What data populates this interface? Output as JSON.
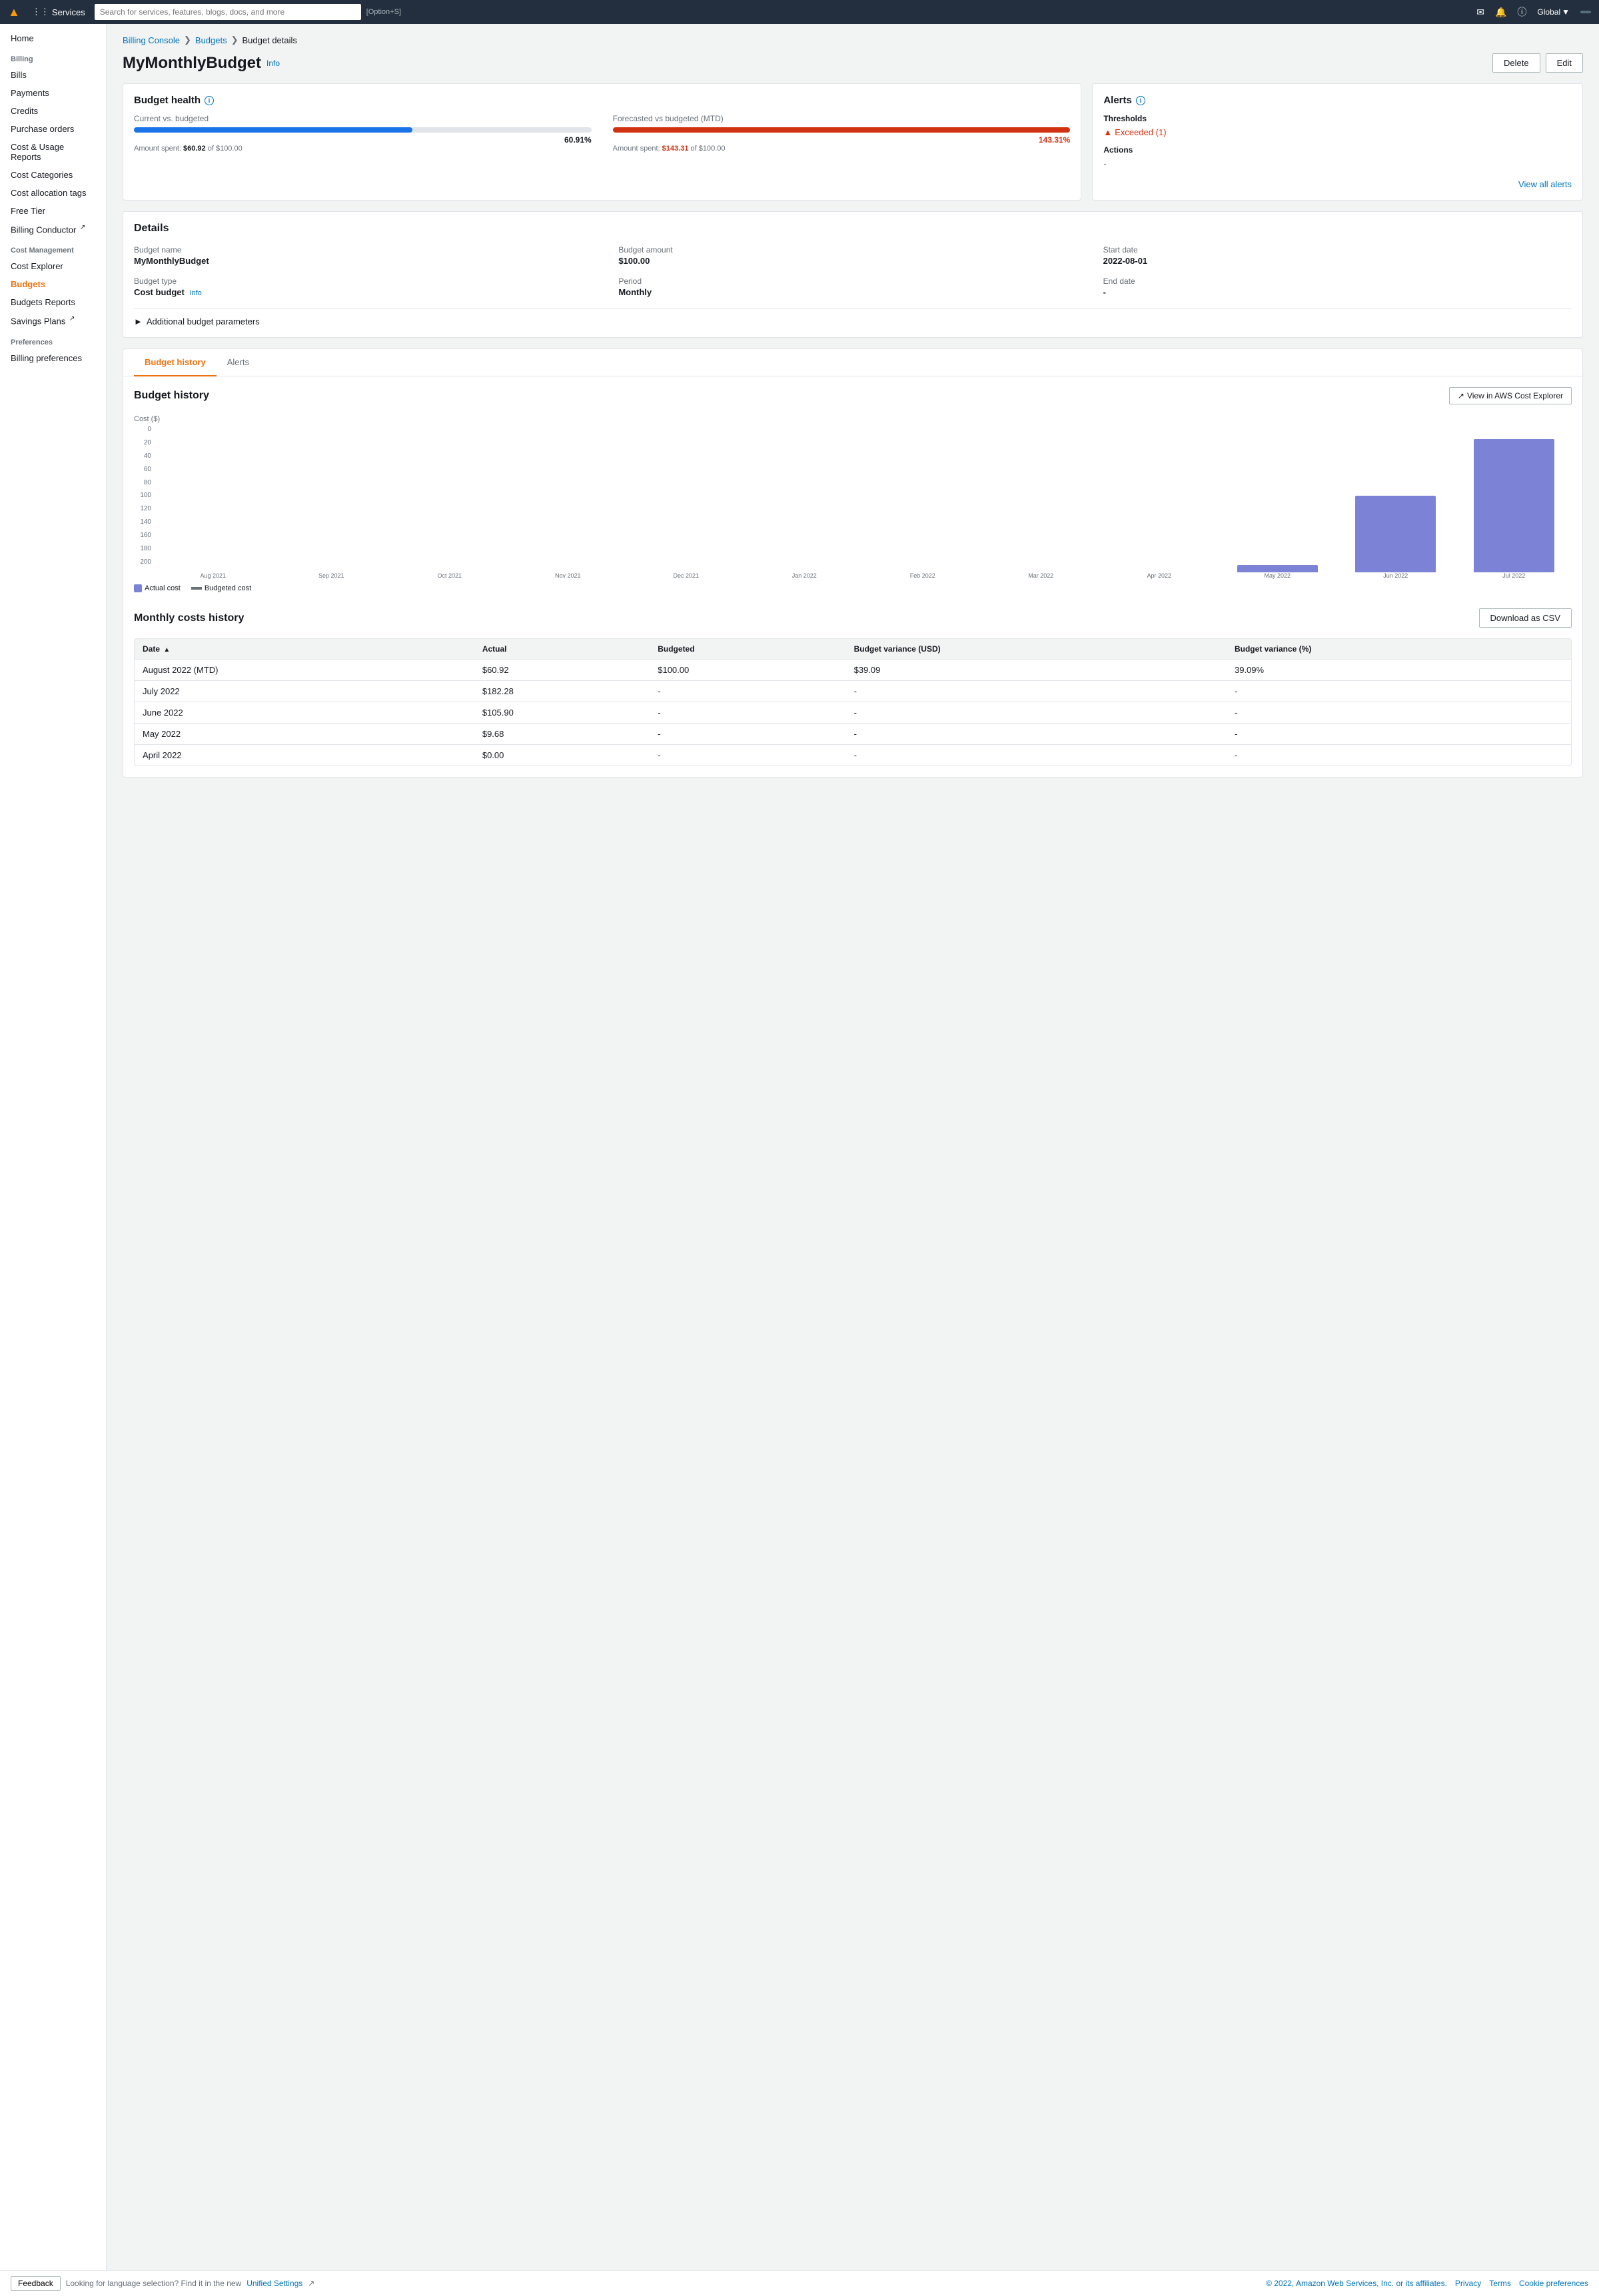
{
  "topnav": {
    "aws_logo": "aws",
    "services_label": "Services",
    "search_placeholder": "Search for services, features, blogs, docs, and more",
    "search_hint": "[Option+S]",
    "global_label": "Global",
    "account_label": ""
  },
  "sidebar": {
    "home_label": "Home",
    "billing_section": "Billing",
    "bills_label": "Bills",
    "payments_label": "Payments",
    "credits_label": "Credits",
    "purchase_orders_label": "Purchase orders",
    "cost_usage_reports_label": "Cost & Usage Reports",
    "cost_categories_label": "Cost Categories",
    "cost_allocation_tags_label": "Cost allocation tags",
    "free_tier_label": "Free Tier",
    "billing_conductor_label": "Billing Conductor",
    "cost_management_section": "Cost Management",
    "cost_explorer_label": "Cost Explorer",
    "budgets_label": "Budgets",
    "budgets_reports_label": "Budgets Reports",
    "savings_plans_label": "Savings Plans",
    "preferences_section": "Preferences",
    "billing_preferences_label": "Billing preferences"
  },
  "breadcrumb": {
    "billing_console": "Billing Console",
    "budgets": "Budgets",
    "budget_details": "Budget details"
  },
  "page": {
    "title": "MyMonthlyBudget",
    "info_label": "Info",
    "delete_label": "Delete",
    "edit_label": "Edit"
  },
  "budget_health": {
    "title": "Budget health",
    "info_label": "Info",
    "current_vs_budgeted_label": "Current vs. budgeted",
    "current_percent": "60.91%",
    "current_bar_width": "60.91",
    "current_amount": "Amount spent: $60.92 of $100.00",
    "current_amount_spent": "$60.92",
    "current_amount_total": "$100.00",
    "forecasted_vs_budgeted_label": "Forecasted vs budgeted (MTD)",
    "forecasted_percent": "143.31%",
    "forecasted_bar_width": "100",
    "forecasted_amount": "Amount spent: $143.31 of $100.00",
    "forecasted_amount_spent": "$143.31",
    "forecasted_amount_total": "$100.00"
  },
  "alerts": {
    "title": "Alerts",
    "info_label": "Info",
    "thresholds_label": "Thresholds",
    "exceeded_label": "Exceeded (1)",
    "actions_label": "Actions",
    "actions_value": "-",
    "view_all_label": "View all alerts"
  },
  "details": {
    "title": "Details",
    "budget_name_label": "Budget name",
    "budget_name_value": "MyMonthlyBudget",
    "budget_amount_label": "Budget amount",
    "budget_amount_value": "$100.00",
    "start_date_label": "Start date",
    "start_date_value": "2022-08-01",
    "budget_type_label": "Budget type",
    "budget_type_value": "Cost budget",
    "budget_type_info": "Info",
    "period_label": "Period",
    "period_value": "Monthly",
    "end_date_label": "End date",
    "end_date_value": "-",
    "additional_params_label": "Additional budget parameters"
  },
  "tabs": {
    "budget_history_label": "Budget history",
    "alerts_label": "Alerts"
  },
  "budget_history": {
    "title": "Budget history",
    "view_in_explorer_label": "View in AWS Cost Explorer",
    "cost_axis_label": "Cost ($)",
    "y_axis": [
      "0",
      "20",
      "40",
      "60",
      "80",
      "100",
      "120",
      "140",
      "160",
      "180",
      "200"
    ],
    "x_labels": [
      "Aug 2021",
      "Sep 2021",
      "Oct 2021",
      "Nov 2021",
      "Dec 2021",
      "Jan 2022",
      "Feb 2022",
      "Mar 2022",
      "Apr 2022",
      "May 2022",
      "Jun 2022",
      "Jul 2022"
    ],
    "bar_values": [
      0,
      0,
      0,
      0,
      0,
      0,
      0,
      0,
      0,
      10,
      105,
      182
    ],
    "max_value": 200,
    "legend_actual": "Actual cost",
    "legend_budgeted": "Budgeted cost",
    "current_bar_partial": 61
  },
  "monthly_costs": {
    "title": "Monthly costs history",
    "download_csv_label": "Download as CSV",
    "columns": {
      "date": "Date",
      "actual": "Actual",
      "budgeted": "Budgeted",
      "variance_usd": "Budget variance (USD)",
      "variance_pct": "Budget variance (%)"
    },
    "rows": [
      {
        "date": "August 2022 (MTD)",
        "actual": "$60.92",
        "budgeted": "$100.00",
        "variance_usd": "$39.09",
        "variance_pct": "39.09%"
      },
      {
        "date": "July 2022",
        "actual": "$182.28",
        "budgeted": "-",
        "variance_usd": "-",
        "variance_pct": "-"
      },
      {
        "date": "June 2022",
        "actual": "$105.90",
        "budgeted": "-",
        "variance_usd": "-",
        "variance_pct": "-"
      },
      {
        "date": "May 2022",
        "actual": "$9.68",
        "budgeted": "-",
        "variance_usd": "-",
        "variance_pct": "-"
      },
      {
        "date": "April 2022",
        "actual": "$0.00",
        "budgeted": "-",
        "variance_usd": "-",
        "variance_pct": "-"
      }
    ]
  },
  "footer": {
    "feedback_label": "Feedback",
    "language_notice": "Looking for language selection? Find it in the new",
    "unified_settings_label": "Unified Settings",
    "copyright": "© 2022, Amazon Web Services, Inc. or its affiliates.",
    "privacy_label": "Privacy",
    "terms_label": "Terms",
    "cookie_prefs_label": "Cookie preferences"
  }
}
